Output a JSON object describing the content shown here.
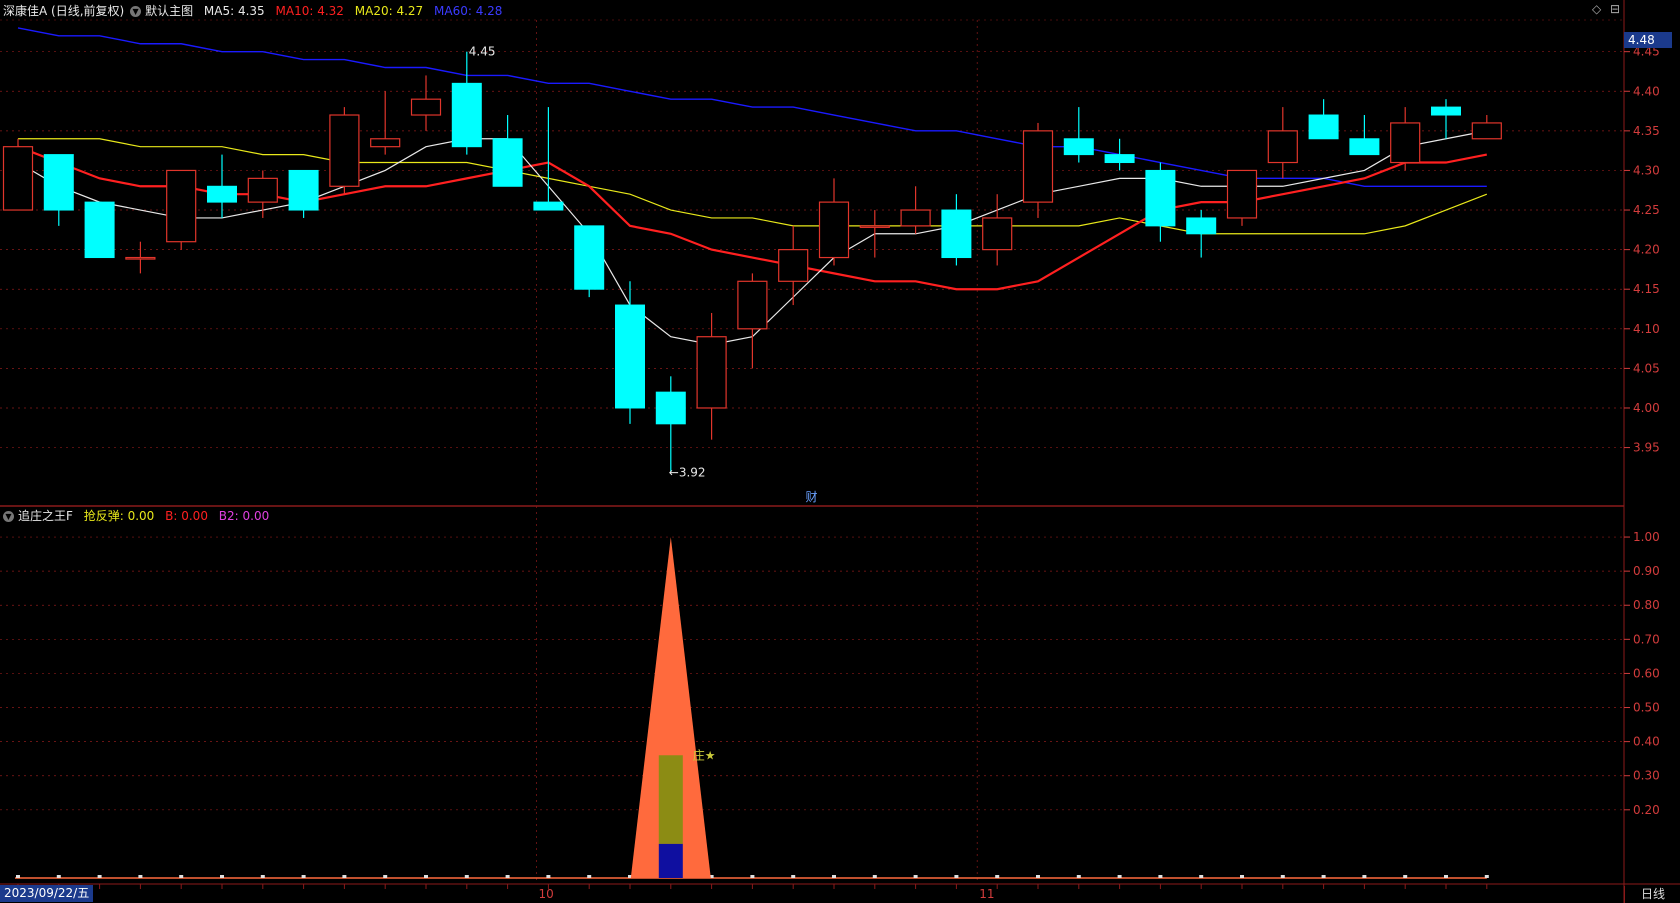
{
  "header": {
    "stock": "深康佳A",
    "period": "(日线,前复权)",
    "template": "默认主图",
    "ma5_label": "MA5: 4.35",
    "ma10_label": "MA10: 4.32",
    "ma20_label": "MA20: 4.27",
    "ma60_label": "MA60: 4.28"
  },
  "indicator": {
    "name": "追庄之王F",
    "rebound_label": "抢反弹: 0.00",
    "b_label": "B: 0.00",
    "b2_label": "B2: 0.00",
    "signal_text": "庄★",
    "value": 0
  },
  "last_price": "4.48",
  "date_label": "2023/09/22/五",
  "timeframe": "日线",
  "marker_cai": "财",
  "annotations": {
    "high": "4.45",
    "low": "←3.92"
  },
  "month_labels": {
    "oct": "10",
    "nov": "11"
  },
  "colors": {
    "up": "#e0352b",
    "down": "#00ffff",
    "ma5": "#e8e8e8",
    "ma10": "#ff2020",
    "ma20": "#e8e81a",
    "ma60": "#1a1aff",
    "grid": "#8b1a1a",
    "axis_text": "#d23c3c",
    "cone": "#ff6a3d",
    "bar_olive": "#8c8c14",
    "bar_blue": "#0f0fa0",
    "ind_line": "#ff6a3d"
  },
  "chart_data": [
    {
      "type": "candlestick",
      "ylim": [
        3.88,
        4.49
      ],
      "y_ticks": [
        "4.45",
        "4.40",
        "4.35",
        "4.30",
        "4.25",
        "4.20",
        "4.15",
        "4.10",
        "4.05",
        "4.00",
        "3.95"
      ],
      "candles": [
        {
          "o": 4.25,
          "h": 4.34,
          "l": 4.25,
          "c": 4.33
        },
        {
          "o": 4.32,
          "h": 4.32,
          "l": 4.23,
          "c": 4.25
        },
        {
          "o": 4.26,
          "h": 4.26,
          "l": 4.19,
          "c": 4.19
        },
        {
          "o": 4.19,
          "h": 4.21,
          "l": 4.17,
          "c": 4.19
        },
        {
          "o": 4.21,
          "h": 4.3,
          "l": 4.2,
          "c": 4.3
        },
        {
          "o": 4.28,
          "h": 4.32,
          "l": 4.24,
          "c": 4.26
        },
        {
          "o": 4.26,
          "h": 4.3,
          "l": 4.24,
          "c": 4.29
        },
        {
          "o": 4.3,
          "h": 4.3,
          "l": 4.24,
          "c": 4.25
        },
        {
          "o": 4.28,
          "h": 4.38,
          "l": 4.27,
          "c": 4.37
        },
        {
          "o": 4.33,
          "h": 4.4,
          "l": 4.32,
          "c": 4.34
        },
        {
          "o": 4.37,
          "h": 4.42,
          "l": 4.35,
          "c": 4.39
        },
        {
          "o": 4.41,
          "h": 4.45,
          "l": 4.32,
          "c": 4.33
        },
        {
          "o": 4.34,
          "h": 4.37,
          "l": 4.28,
          "c": 4.28
        },
        {
          "o": 4.26,
          "h": 4.38,
          "l": 4.25,
          "c": 4.25
        },
        {
          "o": 4.23,
          "h": 4.23,
          "l": 4.14,
          "c": 4.15
        },
        {
          "o": 4.13,
          "h": 4.16,
          "l": 3.98,
          "c": 4.0
        },
        {
          "o": 4.02,
          "h": 4.04,
          "l": 3.92,
          "c": 3.98
        },
        {
          "o": 4.0,
          "h": 4.12,
          "l": 3.96,
          "c": 4.09
        },
        {
          "o": 4.1,
          "h": 4.17,
          "l": 4.05,
          "c": 4.16
        },
        {
          "o": 4.16,
          "h": 4.23,
          "l": 4.13,
          "c": 4.2
        },
        {
          "o": 4.19,
          "h": 4.29,
          "l": 4.18,
          "c": 4.26
        },
        {
          "o": 4.23,
          "h": 4.25,
          "l": 4.19,
          "c": 4.23
        },
        {
          "o": 4.23,
          "h": 4.28,
          "l": 4.22,
          "c": 4.25
        },
        {
          "o": 4.25,
          "h": 4.27,
          "l": 4.18,
          "c": 4.19
        },
        {
          "o": 4.2,
          "h": 4.27,
          "l": 4.18,
          "c": 4.24
        },
        {
          "o": 4.26,
          "h": 4.36,
          "l": 4.24,
          "c": 4.35
        },
        {
          "o": 4.34,
          "h": 4.38,
          "l": 4.31,
          "c": 4.32
        },
        {
          "o": 4.32,
          "h": 4.34,
          "l": 4.3,
          "c": 4.31
        },
        {
          "o": 4.3,
          "h": 4.31,
          "l": 4.21,
          "c": 4.23
        },
        {
          "o": 4.24,
          "h": 4.25,
          "l": 4.19,
          "c": 4.22
        },
        {
          "o": 4.24,
          "h": 4.3,
          "l": 4.23,
          "c": 4.3
        },
        {
          "o": 4.31,
          "h": 4.38,
          "l": 4.29,
          "c": 4.35
        },
        {
          "o": 4.37,
          "h": 4.39,
          "l": 4.34,
          "c": 4.34
        },
        {
          "o": 4.34,
          "h": 4.37,
          "l": 4.32,
          "c": 4.32
        },
        {
          "o": 4.31,
          "h": 4.38,
          "l": 4.3,
          "c": 4.36
        },
        {
          "o": 4.38,
          "h": 4.39,
          "l": 4.34,
          "c": 4.37
        },
        {
          "o": 4.34,
          "h": 4.37,
          "l": 4.34,
          "c": 4.36
        }
      ],
      "ma5": [
        4.31,
        4.28,
        4.26,
        4.25,
        4.24,
        4.24,
        4.25,
        4.26,
        4.28,
        4.3,
        4.33,
        4.34,
        4.34,
        4.28,
        4.22,
        4.13,
        4.09,
        4.08,
        4.09,
        4.14,
        4.19,
        4.22,
        4.22,
        4.23,
        4.25,
        4.27,
        4.28,
        4.29,
        4.29,
        4.28,
        4.28,
        4.28,
        4.29,
        4.3,
        4.33,
        4.34,
        4.35
      ],
      "ma10": [
        4.33,
        4.31,
        4.29,
        4.28,
        4.28,
        4.27,
        4.27,
        4.26,
        4.27,
        4.28,
        4.28,
        4.29,
        4.3,
        4.31,
        4.28,
        4.23,
        4.22,
        4.2,
        4.19,
        4.18,
        4.17,
        4.16,
        4.16,
        4.15,
        4.15,
        4.16,
        4.19,
        4.22,
        4.25,
        4.26,
        4.26,
        4.27,
        4.28,
        4.29,
        4.31,
        4.31,
        4.32
      ],
      "ma20": [
        4.34,
        4.34,
        4.34,
        4.33,
        4.33,
        4.33,
        4.32,
        4.32,
        4.31,
        4.31,
        4.31,
        4.31,
        4.3,
        4.29,
        4.28,
        4.27,
        4.25,
        4.24,
        4.24,
        4.23,
        4.23,
        4.23,
        4.23,
        4.23,
        4.23,
        4.23,
        4.23,
        4.24,
        4.23,
        4.22,
        4.22,
        4.22,
        4.22,
        4.22,
        4.23,
        4.25,
        4.27
      ],
      "ma60": [
        4.48,
        4.47,
        4.47,
        4.46,
        4.46,
        4.45,
        4.45,
        4.44,
        4.44,
        4.43,
        4.43,
        4.42,
        4.42,
        4.41,
        4.41,
        4.4,
        4.39,
        4.39,
        4.38,
        4.38,
        4.37,
        4.36,
        4.35,
        4.35,
        4.34,
        4.33,
        4.33,
        4.32,
        4.31,
        4.3,
        4.29,
        4.29,
        4.29,
        4.28,
        4.28,
        4.28,
        4.28
      ]
    },
    {
      "type": "bar",
      "ylim": [
        0,
        1.05
      ],
      "y_ticks": [
        "1.00",
        "0.90",
        "0.80",
        "0.70",
        "0.60",
        "0.50",
        "0.40",
        "0.30",
        "0.20"
      ],
      "cone_peak_index": 16,
      "cone_peak": 1.0,
      "olive_bar": {
        "index": 16,
        "bottom": 0.1,
        "top": 0.36
      },
      "blue_bar": {
        "index": 16,
        "bottom": 0.0,
        "top": 0.1
      }
    }
  ]
}
